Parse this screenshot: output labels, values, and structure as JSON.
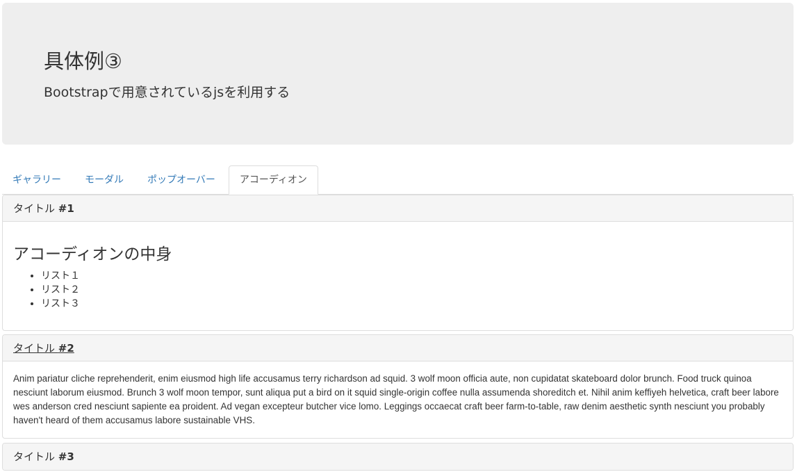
{
  "jumbotron": {
    "title": "具体例③",
    "subtitle": "Bootstrapで用意されているjsを利用する"
  },
  "tabs": [
    {
      "label": "ギャラリー",
      "active": false
    },
    {
      "label": "モーダル",
      "active": false
    },
    {
      "label": "ポップオーバー",
      "active": false
    },
    {
      "label": "アコーディオン",
      "active": true
    }
  ],
  "accordion": {
    "panels": [
      {
        "title_text": "タイトル ",
        "title_num": "#1",
        "body_heading": "アコーディオンの中身",
        "list": [
          "リスト１",
          "リスト２",
          "リスト３"
        ]
      },
      {
        "title_text": "タイトル ",
        "title_num": "#2",
        "body_text": "Anim pariatur cliche reprehenderit, enim eiusmod high life accusamus terry richardson ad squid. 3 wolf moon officia aute, non cupidatat skateboard dolor brunch. Food truck quinoa nesciunt laborum eiusmod. Brunch 3 wolf moon tempor, sunt aliqua put a bird on it squid single-origin coffee nulla assumenda shoreditch et. Nihil anim keffiyeh helvetica, craft beer labore wes anderson cred nesciunt sapiente ea proident. Ad vegan excepteur butcher vice lomo. Leggings occaecat craft beer farm-to-table, raw denim aesthetic synth nesciunt you probably haven't heard of them accusamus labore sustainable VHS."
      },
      {
        "title_text": "タイトル ",
        "title_num": "#3"
      }
    ]
  }
}
